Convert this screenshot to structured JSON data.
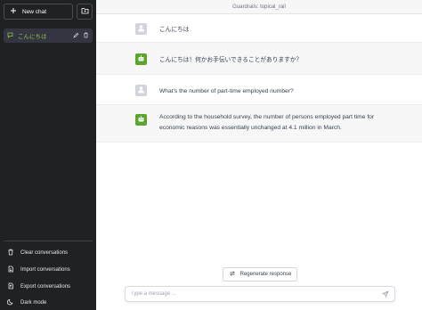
{
  "sidebar": {
    "new_chat_label": "New chat",
    "conversations": [
      {
        "label": "こんにちは"
      }
    ],
    "bottom": [
      {
        "label": "Clear conversations",
        "icon": "trash-icon"
      },
      {
        "label": "Import conversations",
        "icon": "import-icon"
      },
      {
        "label": "Export conversations",
        "icon": "export-icon"
      },
      {
        "label": "Dark mode",
        "icon": "moon-icon"
      }
    ]
  },
  "main": {
    "title": "Guardrails: topical_rail",
    "messages": [
      {
        "role": "user",
        "text": "こんにちは"
      },
      {
        "role": "assistant",
        "text": "こんにちは！何かお手伝いできることがありますか？"
      },
      {
        "role": "user",
        "text": "What's the number of part-time employed number?"
      },
      {
        "role": "assistant",
        "text": "According to the household survey, the number of persons employed part time for economic reasons was essentially unchanged at 4.1 million in March."
      }
    ],
    "regenerate_label": "Regenerate response",
    "input": {
      "placeholder": "Type a message ...",
      "value": ""
    }
  },
  "colors": {
    "sidebar_bg": "#202123",
    "accent_green": "#5aa52c",
    "active_label": "#8bc34a"
  }
}
